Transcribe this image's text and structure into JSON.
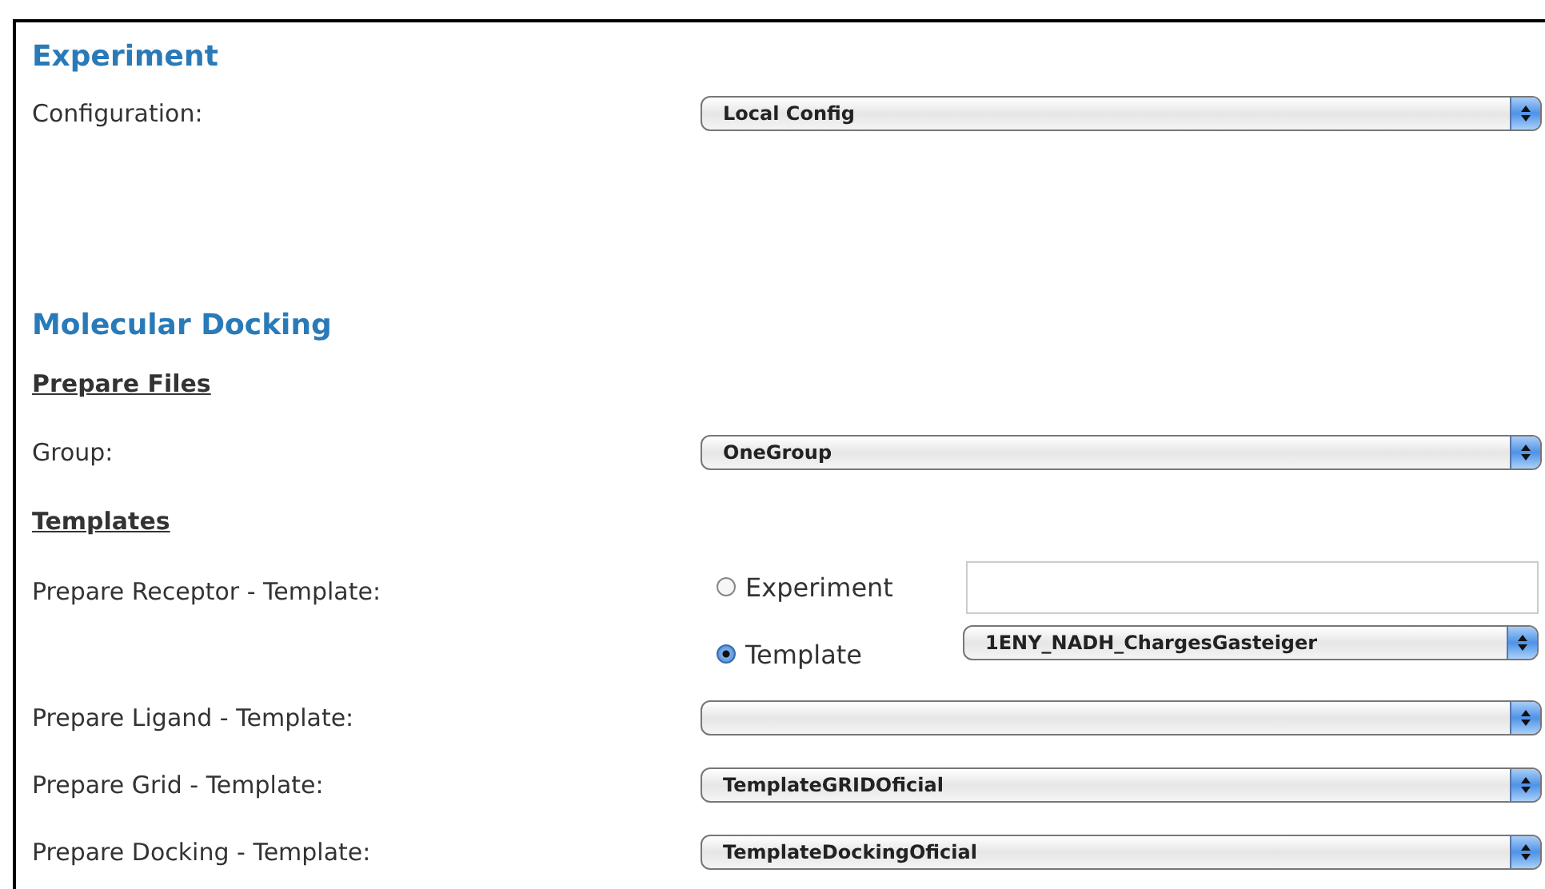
{
  "rows": [
    {
      "kind": "heading",
      "text": "Experiment"
    },
    {
      "kind": "select",
      "label": "Configuration:",
      "value": "Local Config"
    },
    {
      "kind": "heading",
      "text": "Molecular Docking"
    },
    {
      "kind": "subheading",
      "text": "Prepare Files"
    },
    {
      "kind": "select",
      "label": "Group:",
      "value": "OneGroup"
    },
    {
      "kind": "subheading",
      "text": "Templates"
    },
    {
      "kind": "choice",
      "label": "Prepare Receptor - Template:",
      "options": [
        {
          "label": "Experiment",
          "selected": false,
          "field": {
            "kind": "text"
          }
        },
        {
          "label": "Template",
          "selected": true,
          "field": {
            "kind": "select",
            "value": "1ENY_NADH_ChargesGasteiger"
          }
        }
      ]
    },
    {
      "kind": "select",
      "label": "Prepare Ligand - Template:"
    },
    {
      "kind": "select",
      "label": "Prepare Grid - Template:",
      "value": "TemplateGRIDOficial"
    },
    {
      "kind": "select",
      "label": "Prepare Docking - Template:",
      "value": "TemplateDockingOficial"
    }
  ]
}
